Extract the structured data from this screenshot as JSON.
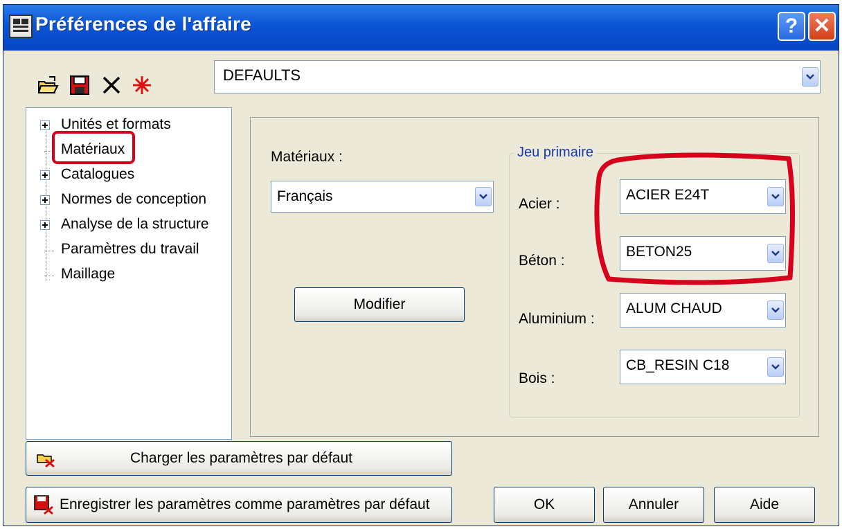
{
  "window": {
    "title": "Préférences de l'affaire",
    "help_label": "?",
    "close_label": "✕"
  },
  "toolbar": {
    "icons": [
      "open-folder-icon",
      "save-icon",
      "delete-icon",
      "new-star-icon"
    ]
  },
  "profile": {
    "selected": "DEFAULTS"
  },
  "tree": {
    "items": [
      {
        "label": "Unités et formats",
        "expandable": true
      },
      {
        "label": "Matériaux",
        "expandable": false,
        "selected": true
      },
      {
        "label": "Catalogues",
        "expandable": true
      },
      {
        "label": "Normes de conception",
        "expandable": true
      },
      {
        "label": "Analyse de la structure",
        "expandable": true
      },
      {
        "label": "Paramètres du travail",
        "expandable": false
      },
      {
        "label": "Maillage",
        "expandable": false
      }
    ]
  },
  "materials": {
    "label": "Matériaux :",
    "database_selected": "Français",
    "modify_label": "Modifier"
  },
  "primary_set": {
    "title": "Jeu primaire",
    "steel_label": "Acier :",
    "steel_value": "ACIER E24T",
    "concrete_label": "Béton :",
    "concrete_value": "BETON25",
    "aluminium_label": "Aluminium :",
    "aluminium_value": "ALUM CHAUD",
    "wood_label": "Bois :",
    "wood_value": "CB_RESIN C18"
  },
  "actions": {
    "load_defaults": "Charger les paramètres par défaut",
    "save_defaults": "Enregistrer les paramètres comme paramètres par défaut",
    "ok": "OK",
    "cancel": "Annuler",
    "help": "Aide"
  },
  "colors": {
    "titlebar": "#0a54d6",
    "highlight_red": "#d6001c",
    "dialog_bg": "#ece9d8"
  }
}
